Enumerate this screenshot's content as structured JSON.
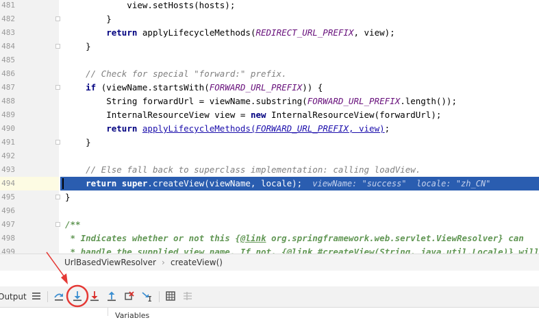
{
  "editor": {
    "lines": [
      {
        "n": "481",
        "fold": false,
        "code": [
          {
            "t": "            view.setHosts(hosts);"
          }
        ]
      },
      {
        "n": "482",
        "fold": true,
        "code": [
          {
            "t": "        }"
          }
        ]
      },
      {
        "n": "483",
        "fold": false,
        "code": [
          {
            "t": "        "
          },
          {
            "t": "return",
            "c": "kw"
          },
          {
            "t": " applyLifecycleMethods("
          },
          {
            "t": "REDIRECT_URL_PREFIX",
            "c": "cst"
          },
          {
            "t": ", view);"
          }
        ]
      },
      {
        "n": "484",
        "fold": true,
        "code": [
          {
            "t": "    }"
          }
        ]
      },
      {
        "n": "485",
        "fold": false,
        "code": []
      },
      {
        "n": "486",
        "fold": false,
        "code": [
          {
            "t": "    "
          },
          {
            "t": "// Check for special \"forward:\" prefix.",
            "c": "cm"
          }
        ]
      },
      {
        "n": "487",
        "fold": true,
        "code": [
          {
            "t": "    "
          },
          {
            "t": "if",
            "c": "kw"
          },
          {
            "t": " (viewName.startsWith("
          },
          {
            "t": "FORWARD_URL_PREFIX",
            "c": "cst"
          },
          {
            "t": ")) {"
          }
        ]
      },
      {
        "n": "488",
        "fold": false,
        "code": [
          {
            "t": "        String forwardUrl = viewName.substring("
          },
          {
            "t": "FORWARD_URL_PREFIX",
            "c": "cst"
          },
          {
            "t": ".length());"
          }
        ]
      },
      {
        "n": "489",
        "fold": false,
        "code": [
          {
            "t": "        InternalResourceView view = "
          },
          {
            "t": "new",
            "c": "kw"
          },
          {
            "t": " InternalResourceView(forwardUrl);"
          }
        ]
      },
      {
        "n": "490",
        "fold": false,
        "code": [
          {
            "t": "        "
          },
          {
            "t": "return",
            "c": "kw"
          },
          {
            "t": " "
          },
          {
            "t": "applyLifecycleMethods(",
            "c": "lnk"
          },
          {
            "t": "FORWARD_URL_PREFIX",
            "c": "lnk cst"
          },
          {
            "t": ", view)",
            "c": "lnk"
          },
          {
            "t": ";"
          }
        ]
      },
      {
        "n": "491",
        "fold": true,
        "code": [
          {
            "t": "    }"
          }
        ]
      },
      {
        "n": "492",
        "fold": false,
        "code": []
      },
      {
        "n": "493",
        "fold": false,
        "code": [
          {
            "t": "    "
          },
          {
            "t": "// Else fall back to superclass implementation: calling loadView.",
            "c": "cm"
          }
        ]
      },
      {
        "n": "494",
        "fold": false,
        "sel": true,
        "code": [
          {
            "t": "    "
          },
          {
            "t": "return super",
            "c": "kw"
          },
          {
            "t": ".createView(viewName, locale);  "
          },
          {
            "t": "viewName: \"success\"  locale: \"zh_CN\"",
            "c": "inl"
          }
        ]
      },
      {
        "n": "495",
        "fold": true,
        "code": [
          {
            "t": "}"
          }
        ]
      },
      {
        "n": "496",
        "fold": false,
        "code": []
      },
      {
        "n": "497",
        "fold": true,
        "code": [
          {
            "t": "/**",
            "c": "dc"
          }
        ]
      },
      {
        "n": "498",
        "fold": false,
        "code": [
          {
            "t": " * Indicates whether or not this {",
            "c": "dc"
          },
          {
            "t": "@link",
            "c": "dc dtag"
          },
          {
            "t": " org.springframework.web.servlet.ViewResolver} can",
            "c": "dc"
          }
        ]
      },
      {
        "n": "499",
        "fold": false,
        "code": [
          {
            "t": " * handle the supplied view name. If not, {",
            "c": "dc"
          },
          {
            "t": "@link",
            "c": "dc dtag"
          },
          {
            "t": " #createView(String, java.util.Locale)} will",
            "c": "dc"
          }
        ]
      }
    ]
  },
  "breadcrumb": {
    "cls": "UrlBasedViewResolver",
    "sep": "›",
    "method": "createView()"
  },
  "debug_toolbar": {
    "tab_label": "Output"
  },
  "variables_panel": {
    "title": "Variables"
  },
  "colors": {
    "selection": "#2a5db0",
    "gutter": "#f2f2f2",
    "annotation_red": "#e53935",
    "toolbar_blue": "#3d8fd1"
  }
}
